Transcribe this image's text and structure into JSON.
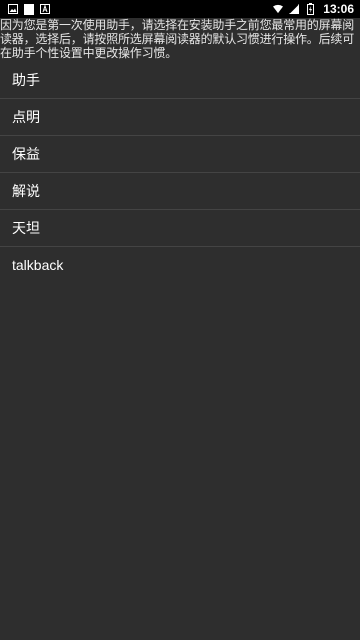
{
  "status_bar": {
    "time": "13:06",
    "left_icons": [
      "image-notification-icon",
      "document-notification-icon",
      "font-notification-icon"
    ],
    "right_icons": [
      "wifi-icon",
      "cellular-signal-icon",
      "battery-icon"
    ]
  },
  "intro_text": "因为您是第一次使用助手，请选择在安装助手之前您最常用的屏幕阅读器，选择后，请按照所选屏幕阅读器的默认习惯进行操作。后续可在助手个性设置中更改操作习惯。",
  "options": [
    {
      "label": "助手"
    },
    {
      "label": "点明"
    },
    {
      "label": "保益"
    },
    {
      "label": "解说"
    },
    {
      "label": "天坦"
    },
    {
      "label": "talkback"
    }
  ],
  "colors": {
    "background": "#2e2e2e",
    "status_bar": "#000000",
    "divider": "#444444",
    "text": "#ffffff"
  }
}
